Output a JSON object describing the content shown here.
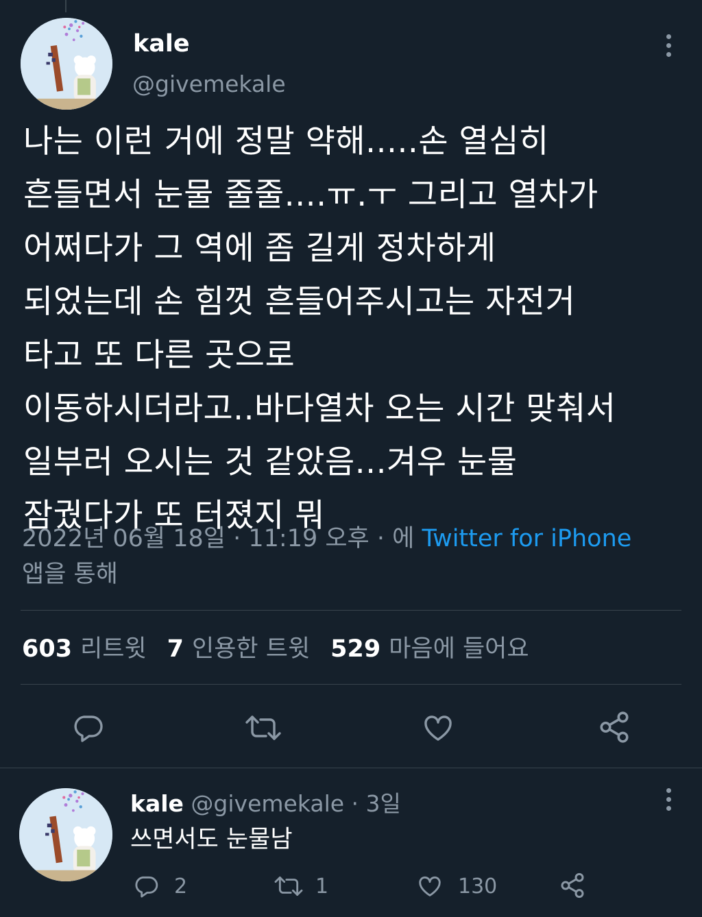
{
  "main_tweet": {
    "name": "kale",
    "handle": "@givemekale",
    "text_lines": [
      "나는 이런 거에 정말 약해.....손 열심히",
      "흔들면서 눈물 줄줄....ㅠ.ㅜ 그리고 열차가",
      "어쩌다가 그 역에 좀 길게 정차하게",
      "되었는데 손 힘껏 흔들어주시고는 자전거",
      "타고 또 다른 곳으로",
      "이동하시더라고..바다열차 오는 시간 맞춰서",
      "일부러 오시는 것 같았음...겨우 눈물",
      "잠궜다가 또 터졌지 뭐"
    ],
    "timestamp": "2022년 06월 18일 · 11:19 오후 · 에",
    "source": "Twitter for iPhone",
    "via_suffix": "앱을 통해",
    "stats": {
      "retweets_count": "603",
      "retweets_label": "리트윗",
      "quotes_count": "7",
      "quotes_label": "인용한 트윗",
      "likes_count": "529",
      "likes_label": "마음에 들어요"
    },
    "actions": [
      "reply-icon",
      "retweet-icon",
      "like-icon",
      "share-icon"
    ]
  },
  "reply_tweet": {
    "name": "kale",
    "handle": "@givemekale",
    "time": "· 3일",
    "text": "쓰면서도 눈물남",
    "reply_count": "2",
    "retweet_count": "1",
    "like_count": "130"
  },
  "colors": {
    "background": "#15202b",
    "text": "#ffffff",
    "secondary": "#8b98a5",
    "link": "#1d9bf0",
    "border": "#38444d"
  }
}
